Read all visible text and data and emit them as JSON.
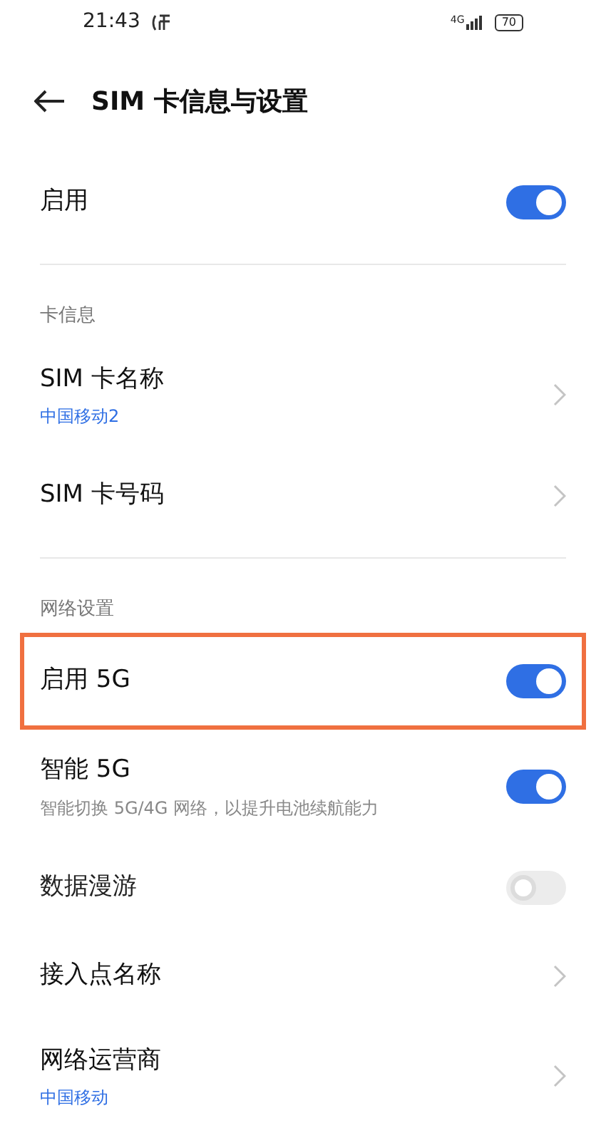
{
  "status_bar": {
    "time": "21:43",
    "network": "4G",
    "battery": "70"
  },
  "header": {
    "title": "SIM 卡信息与设置"
  },
  "items": [
    {
      "kind": "toggle",
      "label": "启用",
      "on": true,
      "disabled": false,
      "highlighted": false
    },
    {
      "kind": "divider"
    },
    {
      "kind": "section",
      "label": "卡信息"
    },
    {
      "kind": "link",
      "label": "SIM 卡名称",
      "subtitle": "中国移动2"
    },
    {
      "kind": "link",
      "label": "SIM 卡号码"
    },
    {
      "kind": "divider"
    },
    {
      "kind": "section",
      "label": "网络设置"
    },
    {
      "kind": "toggle",
      "label": "启用 5G",
      "on": true,
      "disabled": false,
      "highlighted": true
    },
    {
      "kind": "toggle",
      "label": "智能 5G",
      "subtitle": "智能切换 5G/4G 网络，以提升电池续航能力",
      "on": true,
      "disabled": false,
      "highlighted": false
    },
    {
      "kind": "toggle",
      "label": "数据漫游",
      "on": false,
      "disabled": true,
      "highlighted": false
    },
    {
      "kind": "link",
      "label": "接入点名称"
    },
    {
      "kind": "link",
      "label": "网络运营商",
      "subtitle": "中国移动"
    }
  ]
}
